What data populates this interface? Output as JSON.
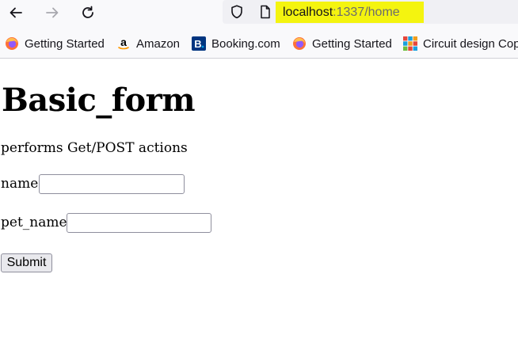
{
  "browser": {
    "icons": {
      "back": "back-arrow-icon",
      "forward": "forward-arrow-icon",
      "reload": "reload-icon",
      "shield": "shield-icon",
      "page": "page-icon"
    },
    "url": {
      "host": "localhost",
      "path": ":1337/home"
    },
    "url_highlight_color": "#f4f40f",
    "bookmarks": [
      {
        "label": "Getting Started",
        "icon": "firefox-icon"
      },
      {
        "label": "Amazon",
        "icon": "amazon-icon"
      },
      {
        "label": "Booking.com",
        "icon": "booking-icon"
      },
      {
        "label": "Getting Started",
        "icon": "firefox-icon"
      },
      {
        "label": "Circuit design Cop",
        "icon": "tinkercad-icon"
      }
    ]
  },
  "page": {
    "title": "Basic_form",
    "subtitle": "performs Get/POST actions",
    "fields": [
      {
        "label": "name",
        "value": ""
      },
      {
        "label": "pet_name",
        "value": ""
      }
    ],
    "submit_label": "Submit"
  }
}
